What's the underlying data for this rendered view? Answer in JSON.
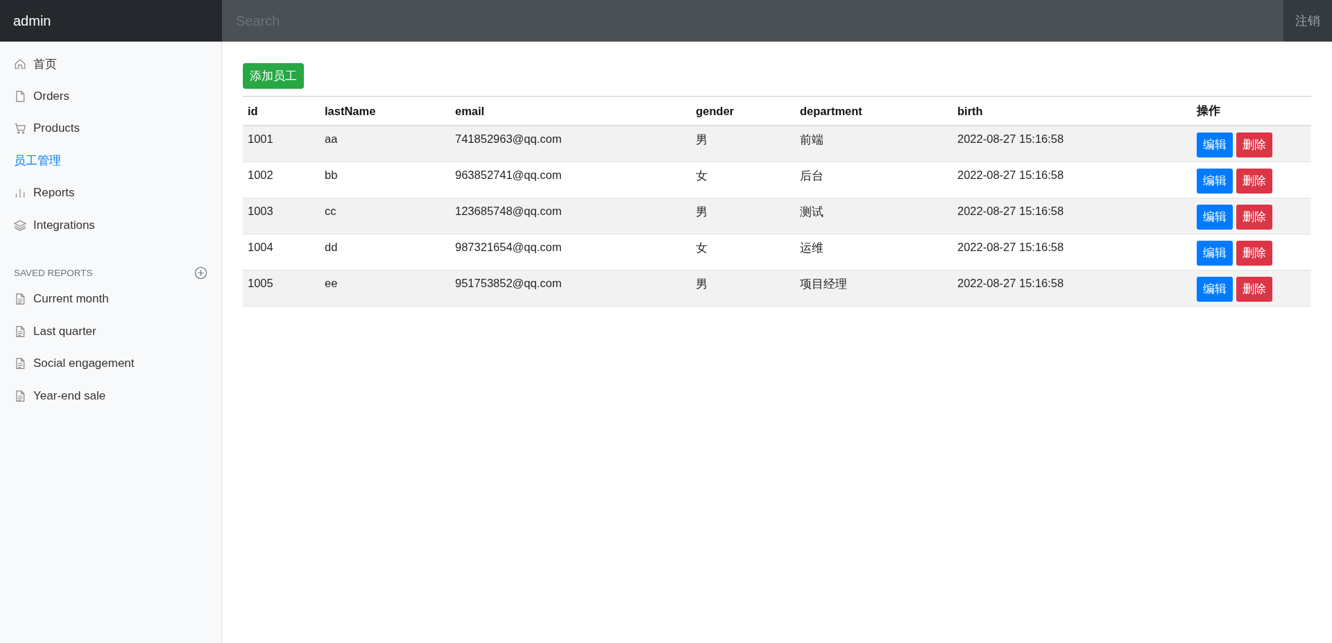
{
  "navbar": {
    "brand": "admin",
    "search": {
      "placeholder": "Search"
    },
    "signout": "注销"
  },
  "sidebar": {
    "items": [
      {
        "label": "首页",
        "selected": false
      },
      {
        "label": "Orders",
        "selected": false
      },
      {
        "label": "Products",
        "selected": false
      },
      {
        "label": "员工管理",
        "selected": true
      },
      {
        "label": "Reports",
        "selected": false
      },
      {
        "label": "Integrations",
        "selected": false
      }
    ],
    "saved_reports": {
      "heading": "SAVED REPORTS",
      "items": [
        "Current month",
        "Last quarter",
        "Social engagement",
        "Year-end sale"
      ]
    }
  },
  "add_button": "添加员工",
  "table": {
    "columns": [
      "id",
      "lastName",
      "email",
      "gender",
      "department",
      "birth",
      "操作"
    ],
    "rows": [
      {
        "cells": [
          "1001",
          "aa",
          "741852963@qq.com",
          "男",
          "前端",
          "2022-08-27 15:16:58"
        ],
        "actions": [
          "编辑",
          "删除"
        ]
      },
      {
        "cells": [
          "1002",
          "bb",
          "963852741@qq.com",
          "女",
          "后台",
          "2022-08-27 15:16:58"
        ],
        "actions": [
          "编辑",
          "删除"
        ]
      },
      {
        "cells": [
          "1003",
          "cc",
          "123685748@qq.com",
          "男",
          "测试",
          "2022-08-27 15:16:58"
        ],
        "actions": [
          "编辑",
          "删除"
        ]
      },
      {
        "cells": [
          "1004",
          "dd",
          "987321654@qq.com",
          "女",
          "运维",
          "2022-08-27 15:16:58"
        ],
        "actions": [
          "编辑",
          "删除"
        ]
      },
      {
        "cells": [
          "1005",
          "ee",
          "951753852@qq.com",
          "男",
          "项目经理",
          "2022-08-27 15:16:58"
        ],
        "actions": [
          "编辑",
          "删除"
        ]
      }
    ]
  }
}
